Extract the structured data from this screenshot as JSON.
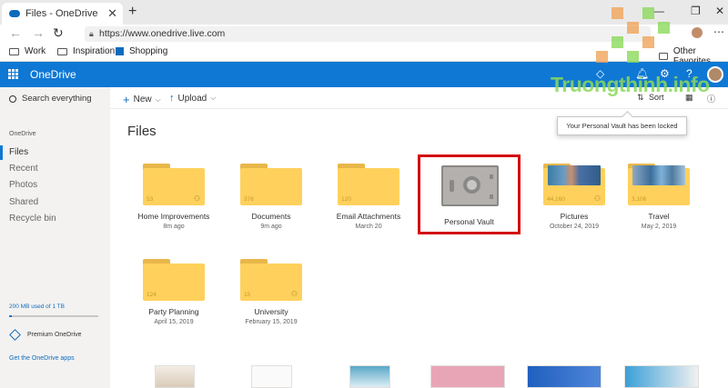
{
  "browser": {
    "tab_title": "Files - OneDrive",
    "url": "https://www.onedrive.live.com",
    "favorites": [
      "Work",
      "Inspiration",
      "Shopping"
    ],
    "other_favorites": "Other Favorites"
  },
  "header": {
    "app_name": "OneDrive"
  },
  "sidebar": {
    "search_placeholder": "Search everything",
    "section": "OneDrive",
    "items": [
      {
        "label": "Files"
      },
      {
        "label": "Recent"
      },
      {
        "label": "Photos"
      },
      {
        "label": "Shared"
      },
      {
        "label": "Recycle bin"
      }
    ],
    "storage_text": "200 MB used of 1 TB",
    "storage_fraction": 0.03,
    "premium": "Premium OneDrive",
    "get_apps": "Get the OneDrive apps"
  },
  "commandbar": {
    "new_label": "New",
    "upload_label": "Upload",
    "sort_label": "Sort"
  },
  "tooltip": "Your Personal Vault has been locked",
  "main": {
    "title": "Files",
    "folders": [
      {
        "name": "Home Improvements",
        "date": "8m ago",
        "count": "53",
        "shared": true
      },
      {
        "name": "Documents",
        "date": "9m ago",
        "count": "376",
        "shared": false
      },
      {
        "name": "Email Attachments",
        "date": "March 20",
        "count": "120",
        "shared": false
      },
      {
        "name": "Personal Vault",
        "date": "",
        "count": "",
        "shared": false
      },
      {
        "name": "Pictures",
        "date": "October 24, 2019",
        "count": "44,160",
        "shared": true
      },
      {
        "name": "Travel",
        "date": "May 2, 2019",
        "count": "3,106",
        "shared": false
      },
      {
        "name": "Party Planning",
        "date": "April 15, 2019",
        "count": "124",
        "shared": false
      },
      {
        "name": "University",
        "date": "February 15, 2019",
        "count": "15",
        "shared": true
      }
    ]
  },
  "watermark": "Truongthinh.info",
  "colors": {
    "accent": "#0f78d4",
    "folder": "#ffd15c",
    "highlight": "#d40f0f"
  }
}
